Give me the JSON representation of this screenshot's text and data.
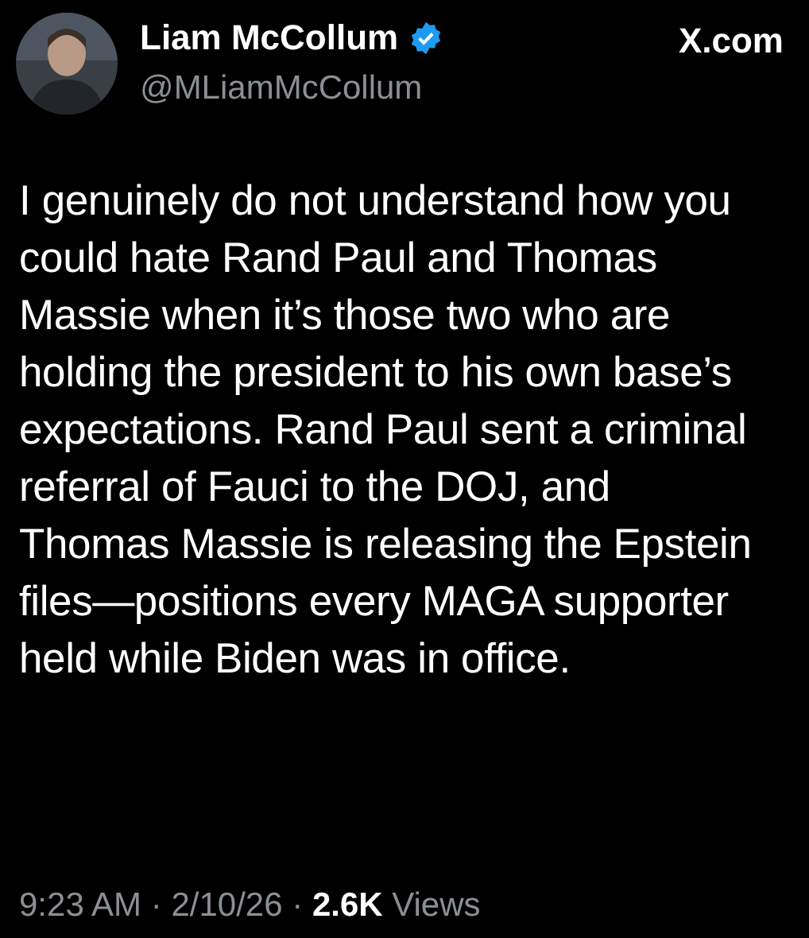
{
  "author": {
    "name": "Liam McCollum",
    "verified": true,
    "handle": "@MLiamMcCollum"
  },
  "source": "X.com",
  "body": "I genuinely do not understand how you could hate Rand Paul and Thomas Massie when it’s those two who are holding the president to his own base’s expectations. Rand Paul sent a criminal referral of Fauci to the DOJ, and Thomas Massie is releasing the Epstein files—positions every MAGA supporter held while Biden was in office.",
  "meta": "9:23 AM · 2/10/26 · **2.6K** Views"
}
